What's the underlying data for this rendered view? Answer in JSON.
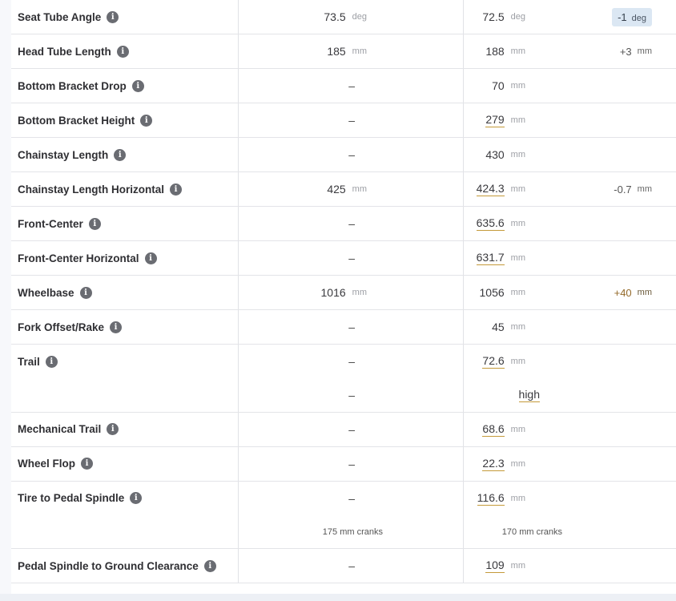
{
  "rows": [
    {
      "label": "Seat Tube Angle",
      "v1": "73.5",
      "u1": "deg",
      "v2": "72.5",
      "u2": "deg",
      "diff": "-1",
      "du": "deg",
      "diff_style": "badge"
    },
    {
      "label": "Head Tube Length",
      "v1": "185",
      "u1": "mm",
      "v2": "188",
      "u2": "mm",
      "diff": "+3",
      "du": "mm",
      "diff_style": "plain"
    },
    {
      "label": "Bottom Bracket Drop",
      "v1": "–",
      "v2": "70",
      "u2": "mm"
    },
    {
      "label": "Bottom Bracket Height",
      "v1": "–",
      "v2": "279",
      "u2": "mm",
      "underline": true
    },
    {
      "label": "Chainstay Length",
      "v1": "–",
      "v2": "430",
      "u2": "mm"
    },
    {
      "label": "Chainstay Length Horizontal",
      "v1": "425",
      "u1": "mm",
      "v2": "424.3",
      "u2": "mm",
      "underline": true,
      "diff": "-0.7",
      "du": "mm",
      "diff_style": "plain"
    },
    {
      "label": "Front-Center",
      "v1": "–",
      "v2": "635.6",
      "u2": "mm",
      "underline": true
    },
    {
      "label": "Front-Center Horizontal",
      "v1": "–",
      "v2": "631.7",
      "u2": "mm",
      "underline": true
    },
    {
      "label": "Wheelbase",
      "v1": "1016",
      "u1": "mm",
      "v2": "1056",
      "u2": "mm",
      "diff": "+40",
      "du": "mm",
      "diff_style": "pos"
    },
    {
      "label": "Fork Offset/Rake",
      "v1": "–",
      "v2": "45",
      "u2": "mm"
    },
    {
      "label": "Trail",
      "v1": "–",
      "v2": "72.6",
      "u2": "mm",
      "underline": true,
      "line2_v1": "–",
      "line2_v2": "high"
    },
    {
      "label": "Mechanical Trail",
      "v1": "–",
      "v2": "68.6",
      "u2": "mm",
      "underline": true
    },
    {
      "label": "Wheel Flop",
      "v1": "–",
      "v2": "22.3",
      "u2": "mm",
      "underline": true
    },
    {
      "label": "Tire to Pedal Spindle",
      "v1": "–",
      "v2": "116.6",
      "u2": "mm",
      "underline": true,
      "line2_v1": "175 mm cranks",
      "line2_v2": "170 mm cranks"
    },
    {
      "label": "Pedal Spindle to Ground Clearance",
      "v1": "–",
      "v2": "109",
      "u2": "mm",
      "underline": true
    }
  ],
  "info_glyph": "i"
}
